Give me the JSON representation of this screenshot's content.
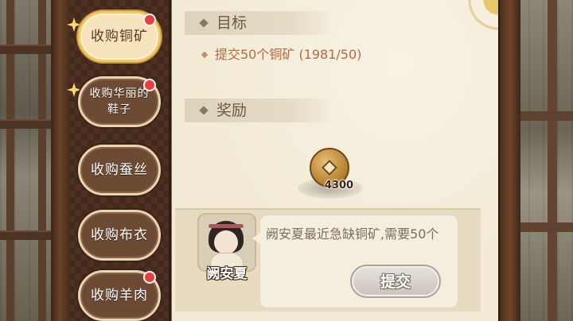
{
  "sidebar": {
    "tabs": [
      {
        "label": "收购铜矿",
        "active": true,
        "badge": true
      },
      {
        "label": "收购华丽的鞋子",
        "active": false,
        "badge": true
      },
      {
        "label": "收购蚕丝",
        "active": false,
        "badge": false
      },
      {
        "label": "收购布衣",
        "active": false,
        "badge": false
      },
      {
        "label": "收购羊肉",
        "active": false,
        "badge": true
      }
    ]
  },
  "quest": {
    "goal_header": "目标",
    "goal_text": "提交50个铜矿 (1981/50)",
    "reward_header": "奖励",
    "reward": {
      "icon": "copper-coin-icon",
      "amount": "4300"
    }
  },
  "npc": {
    "name": "阙安夏",
    "dialogue": "阙安夏最近急缺铜矿,需要50个"
  },
  "actions": {
    "submit_label": "提交"
  },
  "colors": {
    "badge": "#e63f3f",
    "goal_text": "#b36a42",
    "frame": "#4d3021"
  }
}
